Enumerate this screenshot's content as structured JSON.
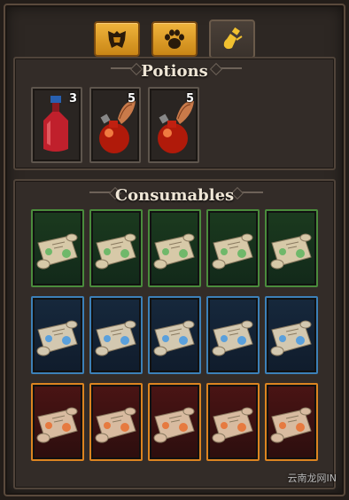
{
  "tabs": [
    {
      "name": "armor",
      "icon": "armor-icon",
      "active": false
    },
    {
      "name": "pets",
      "icon": "paw-icon",
      "active": false
    },
    {
      "name": "consumables",
      "icon": "potion-icon",
      "active": true
    }
  ],
  "potions": {
    "title": "Potions",
    "items": [
      {
        "icon": "red-bottle-icon",
        "count": "3"
      },
      {
        "icon": "winged-potion-icon",
        "count": "5"
      },
      {
        "icon": "winged-potion-icon",
        "count": "5"
      }
    ]
  },
  "consumables": {
    "title": "Consumables",
    "rows": [
      {
        "rarity": "green",
        "count": 5
      },
      {
        "rarity": "blue",
        "count": 5
      },
      {
        "rarity": "orange",
        "count": 5
      }
    ]
  },
  "colors": {
    "green": "#4a8c3c",
    "blue": "#3c80b8",
    "orange": "#dc8420",
    "tab_gold": "#e0a02a"
  },
  "watermark": {
    "text": "云南龙网",
    "suffix": "IN"
  }
}
